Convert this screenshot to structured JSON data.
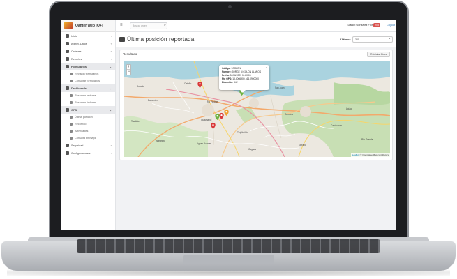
{
  "app": {
    "brand": "Qanter Web [Q+]"
  },
  "sidebar": {
    "items": [
      {
        "label": "Inicio",
        "type": "top",
        "chevron": "‹"
      },
      {
        "label": "Admin. Datos",
        "type": "top",
        "chevron": "‹"
      },
      {
        "label": "Ordenes",
        "type": "top",
        "chevron": "‹"
      },
      {
        "label": "Reportes",
        "type": "top",
        "chevron": "‹"
      },
      {
        "label": "Formularios",
        "type": "active",
        "chevron": "⌄"
      },
      {
        "label": "Revisión formularios",
        "type": "sub"
      },
      {
        "label": "Consultar formularios",
        "type": "sub"
      },
      {
        "label": "Dashboards",
        "type": "active",
        "chevron": "⌄"
      },
      {
        "label": "Resumen lecturas",
        "type": "sub"
      },
      {
        "label": "Resumen órdenes",
        "type": "sub"
      },
      {
        "label": "GPS",
        "type": "active",
        "chevron": "⌄"
      },
      {
        "label": "Última posición",
        "type": "sub"
      },
      {
        "label": "Recorrido",
        "type": "sub"
      },
      {
        "label": "Actividades",
        "type": "sub"
      },
      {
        "label": "Consulta en mapa",
        "type": "sub"
      },
      {
        "label": "Seguridad",
        "type": "top",
        "chevron": "‹"
      },
      {
        "label": "Configuraciones",
        "type": "top",
        "chevron": "‹"
      }
    ]
  },
  "topbar": {
    "menu_icon": "≡",
    "search_placeholder": "Buscar orden",
    "search_icon": "⌕",
    "user_name": "Daniel Gonzalez Flores",
    "badge": "Red",
    "logout": "Logout"
  },
  "page": {
    "title": "Última posición reportada",
    "filter_label": "Últimos",
    "filter_value": "300"
  },
  "panel": {
    "title": "Resultado",
    "reset_button": "Reiniciar filtros"
  },
  "map": {
    "zoom_in": "+",
    "zoom_out": "−",
    "popup": {
      "close": "×",
      "rows": [
        {
          "label": "Código:",
          "value": " 1COLONI"
        },
        {
          "label": "Nombre:",
          "value": " JORGE M COLON LLANOS"
        },
        {
          "label": "Fecha:",
          "value": " 06/06/2023 11:20:06"
        },
        {
          "label": "Pto GPS:",
          "value": " 18.4066900, -66.0900000"
        },
        {
          "label": "Dirección:",
          "value": " 342"
        }
      ]
    },
    "labels": [
      "Bayamón",
      "Guaynabo",
      "Río Piedras",
      "Carolina",
      "Trujillo Alto",
      "Caguas",
      "San Juan",
      "Cataño",
      "Dorado",
      "Loíza",
      "Canóvanas",
      "Río Grande",
      "Toa Alta",
      "Aguas Buenas",
      "Naranjito",
      "Gurabo"
    ],
    "attribution_leaflet": "Leaflet",
    "attribution_rest": " | © OpenStreetMap contributors",
    "marker_colors": {
      "red": "#d9383a",
      "green": "#6db33f",
      "orange": "#f0a030"
    }
  }
}
